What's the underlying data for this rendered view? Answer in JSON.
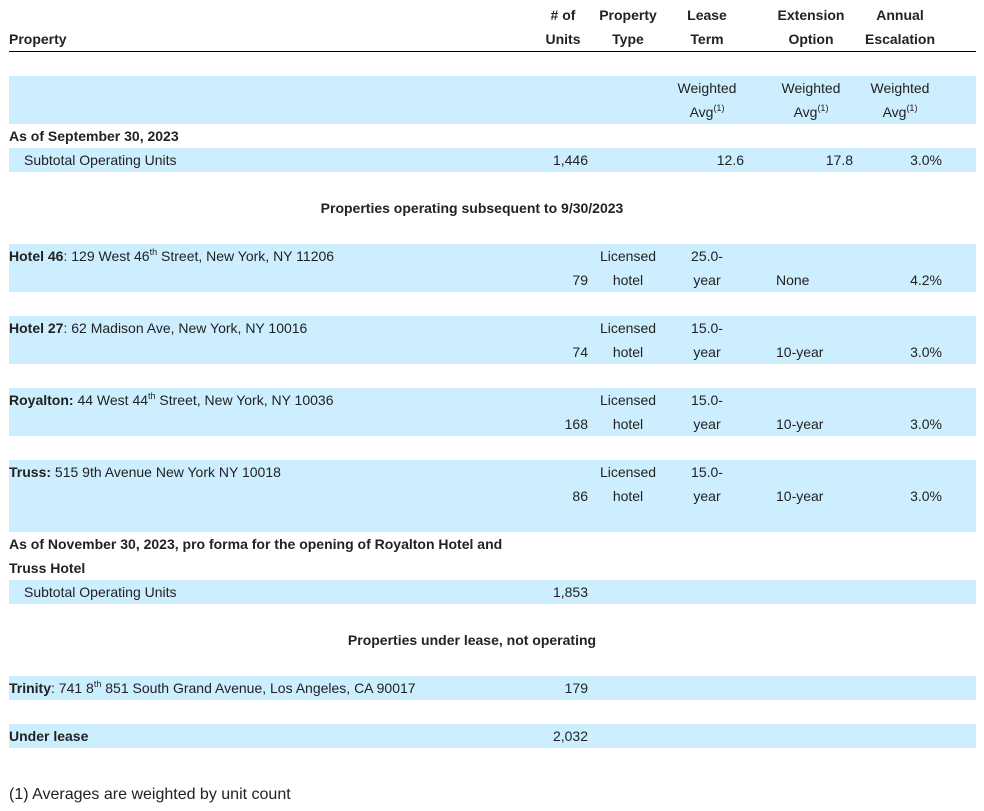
{
  "header": {
    "property": "Property",
    "units_1": "# of",
    "units_2": "Units",
    "type_1": "Property",
    "type_2": "Type",
    "lease_1": "Lease",
    "lease_2": "Term",
    "ext_1": "Extension",
    "ext_2": "Option",
    "esc_1": "Annual",
    "esc_2": "Escalation"
  },
  "weighted": {
    "label": "Weighted",
    "avg": "Avg",
    "note": "(1)"
  },
  "section1": {
    "title": "As of September 30, 2023",
    "subtotal_label": "Subtotal Operating Units",
    "units": "1,446",
    "lease": "12.6",
    "ext": "17.8",
    "esc": "3.0%"
  },
  "section2_title": "Properties operating subsequent to 9/30/2023",
  "properties": [
    {
      "name": "Hotel 46",
      "sep": ": ",
      "addr_pre": "129 West 46",
      "sup": "th",
      "addr_post": " Street, New York, NY 11206",
      "units": "79",
      "type_1": "Licensed",
      "type_2": "hotel",
      "lease_1": "25.0-",
      "lease_2": "year",
      "ext": "None",
      "esc": "4.2%"
    },
    {
      "name": "Hotel 27",
      "sep": ": ",
      "addr_pre": "62 Madison Ave, New York, NY 10016",
      "sup": "",
      "addr_post": "",
      "units": "74",
      "type_1": "Licensed",
      "type_2": "hotel",
      "lease_1": "15.0-",
      "lease_2": "year",
      "ext": "10-year",
      "esc": "3.0%"
    },
    {
      "name": "Royalton:",
      "sep": " ",
      "addr_pre": "44 West 44",
      "sup": "th",
      "addr_post": " Street, New York, NY 10036",
      "units": "168",
      "type_1": "Licensed",
      "type_2": "hotel",
      "lease_1": "15.0-",
      "lease_2": "year",
      "ext": "10-year",
      "esc": "3.0%"
    },
    {
      "name": "Truss:",
      "sep": " ",
      "addr_pre": "515 9th Avenue New York NY 10018",
      "sup": "",
      "addr_post": "",
      "units": "86",
      "type_1": "Licensed",
      "type_2": "hotel",
      "lease_1": "15.0-",
      "lease_2": "year",
      "ext": "10-year",
      "esc": "3.0%"
    }
  ],
  "section3": {
    "title_1": "As of November 30, 2023, pro forma for the opening of Royalton Hotel and",
    "title_2": "Truss Hotel",
    "subtotal_label": "Subtotal Operating Units",
    "units": "1,853"
  },
  "section4_title": "Properties under lease, not operating",
  "trinity": {
    "name": "Trinity",
    "sep": ": ",
    "addr_pre": "741 8",
    "sup": "th",
    "addr_post": " 851 South Grand Avenue, Los Angeles, CA 90017",
    "units": "179"
  },
  "under_lease": {
    "label": "Under lease",
    "units": "2,032"
  },
  "footnote": "(1) Averages are weighted by unit count"
}
